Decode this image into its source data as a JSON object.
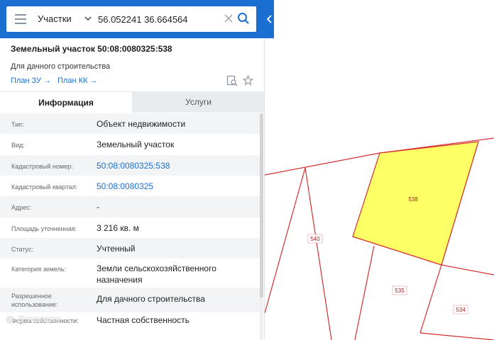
{
  "search": {
    "layer_select": "Участки",
    "query": "56.052241 36.664564"
  },
  "parcel": {
    "title": "Земельный участок 50:08:0080325:538",
    "purpose": "Для дачного строительства",
    "links": [
      "План ЗУ",
      "План КК"
    ]
  },
  "tabs": [
    "Информация",
    "Услуги"
  ],
  "info": [
    {
      "label": "Тип:",
      "value": "Объект недвижимости"
    },
    {
      "label": "Вид:",
      "value": "Земельный участок"
    },
    {
      "label": "Кадастровый номер:",
      "value": "50:08:0080325:538"
    },
    {
      "label": "Кадастровый квартал:",
      "value": "50:08:0080325"
    },
    {
      "label": "Адрес:",
      "value": "-"
    },
    {
      "label": "Площадь уточненная:",
      "value": "3 216 кв. м"
    },
    {
      "label": "Статус:",
      "value": "Учтенный"
    },
    {
      "label": "Категория земель:",
      "value": "Земли сельскохозяйственного назначения"
    },
    {
      "label": "Разрешенное использование:",
      "value": "Для дачного строительства"
    },
    {
      "label": "Форма собственности:",
      "value": "Частная собственность"
    }
  ],
  "map": {
    "parcels": [
      "538",
      "540",
      "535",
      "534"
    ],
    "selected_fill": "#ffff66",
    "boundary_color": "#d32f2f"
  },
  "watermark": "Домклик",
  "colors": {
    "accent": "#1a6fd1"
  }
}
